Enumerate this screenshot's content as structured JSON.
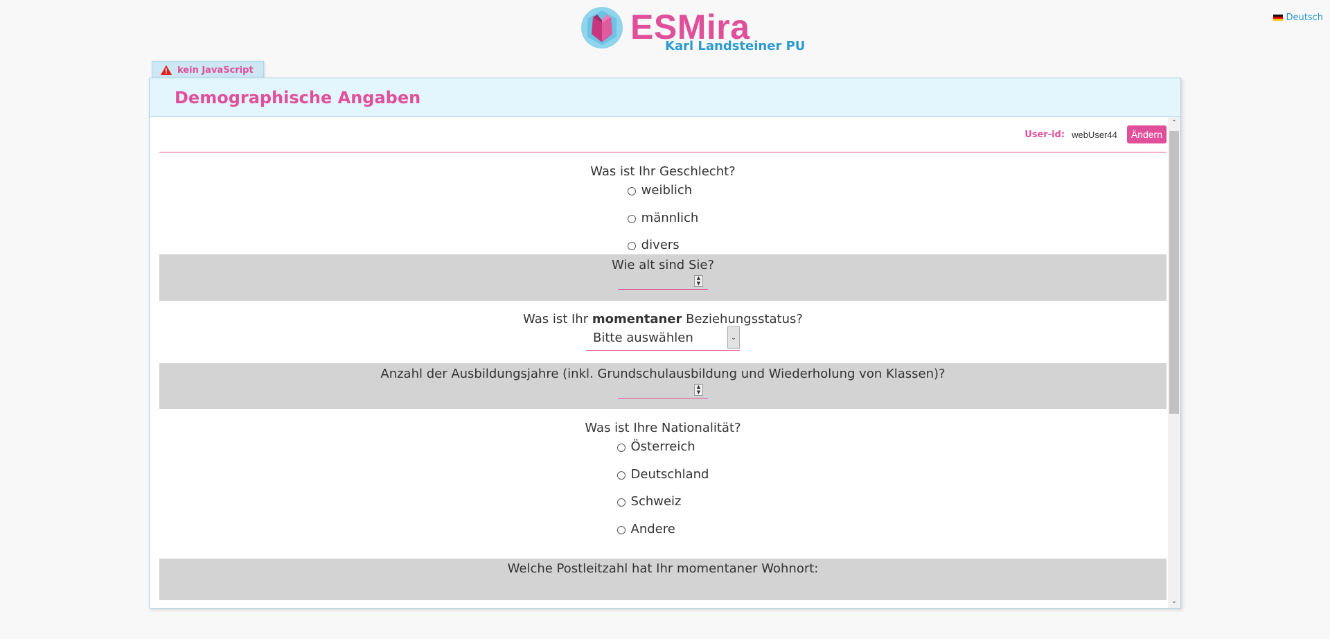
{
  "header": {
    "brand": "ESMira",
    "subtitle": "Karl Landsteiner PU",
    "language": "Deutsch",
    "language_icon": "german-flag-icon"
  },
  "notice_tab": {
    "icon": "warning-triangle-icon",
    "label": "kein JavaScript"
  },
  "page": {
    "title": "Demographische Angaben",
    "user_label": "User-id:",
    "user_id": "webUser44",
    "change_button": "Ändern"
  },
  "questions": {
    "gender": {
      "title": "Was ist Ihr Geschlecht?",
      "options": [
        "weiblich",
        "männlich",
        "divers"
      ]
    },
    "age": {
      "title": "Wie alt sind Sie?"
    },
    "relationship": {
      "title_pre": "Was ist Ihr ",
      "title_bold": "momentaner",
      "title_post": " Beziehungsstatus?",
      "selected": "Bitte auswählen"
    },
    "education": {
      "title": "Anzahl der Ausbildungsjahre (inkl. Grundschulausbildung und Wiederholung von Klassen)?"
    },
    "nationality": {
      "title": "Was ist Ihre Nationalität?",
      "options": [
        "Österreich",
        "Deutschland",
        "Schweiz",
        "Andere"
      ]
    },
    "postal": {
      "title": "Welche Postleitzahl hat Ihr momentaner Wohnort:"
    }
  },
  "colors": {
    "accent": "#df4f9a",
    "brand_blue": "#2a9ad0",
    "panel_head": "#e4f6fd",
    "gray_band": "#d3d3d3"
  }
}
